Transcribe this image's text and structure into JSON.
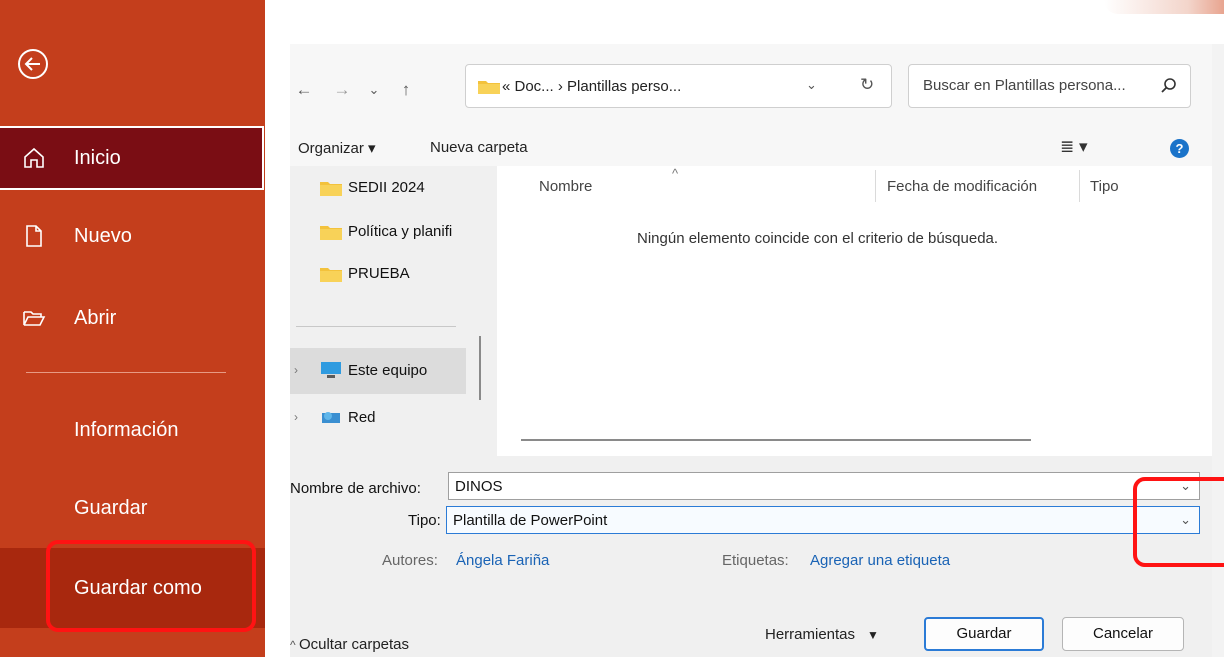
{
  "sidebar": {
    "items": [
      {
        "label": "Inicio",
        "icon": "home-icon"
      },
      {
        "label": "Nuevo",
        "icon": "new-document-icon"
      },
      {
        "label": "Abrir",
        "icon": "open-folder-icon"
      },
      {
        "label": "Información"
      },
      {
        "label": "Guardar"
      },
      {
        "label": "Guardar como"
      }
    ],
    "back_icon": "back-arrow-icon"
  },
  "address_bar": {
    "crumbs": "« Doc...  ›  Plantillas perso...",
    "search_placeholder": "Buscar en Plantillas persona..."
  },
  "toolbar": {
    "organize_label": "Organizar ▾",
    "new_folder_label": "Nueva carpeta"
  },
  "nav_pane": {
    "items": [
      {
        "label": "SEDII 2024",
        "icon": "folder-icon"
      },
      {
        "label": "Política y planifi",
        "icon": "folder-icon"
      },
      {
        "label": "PRUEBA",
        "icon": "folder-icon"
      },
      {
        "label": "Este equipo",
        "icon": "computer-icon"
      },
      {
        "label": "Red",
        "icon": "network-icon"
      }
    ]
  },
  "file_list": {
    "columns": [
      "Nombre",
      "Fecha de modificación",
      "Tipo"
    ],
    "empty_message": "Ningún elemento coincide con el criterio de búsqueda."
  },
  "form": {
    "filename_label": "Nombre de archivo:",
    "filename_value": "DINOS",
    "type_label": "Tipo:",
    "type_value": "Plantilla de PowerPoint",
    "authors_label": "Autores:",
    "authors_value": "Ángela Fariña",
    "tags_label": "Etiquetas:",
    "tags_value": "Agregar una etiqueta"
  },
  "footer": {
    "hide_folders_label": "Ocultar carpetas",
    "tools_label": "Herramientas",
    "save_label": "Guardar",
    "cancel_label": "Cancelar"
  },
  "colors": {
    "sidebar_bg": "#c43e1c",
    "selected_bg": "#7a0d14",
    "accent_blue": "#2b7bd6",
    "callout_red": "#ff1313"
  }
}
